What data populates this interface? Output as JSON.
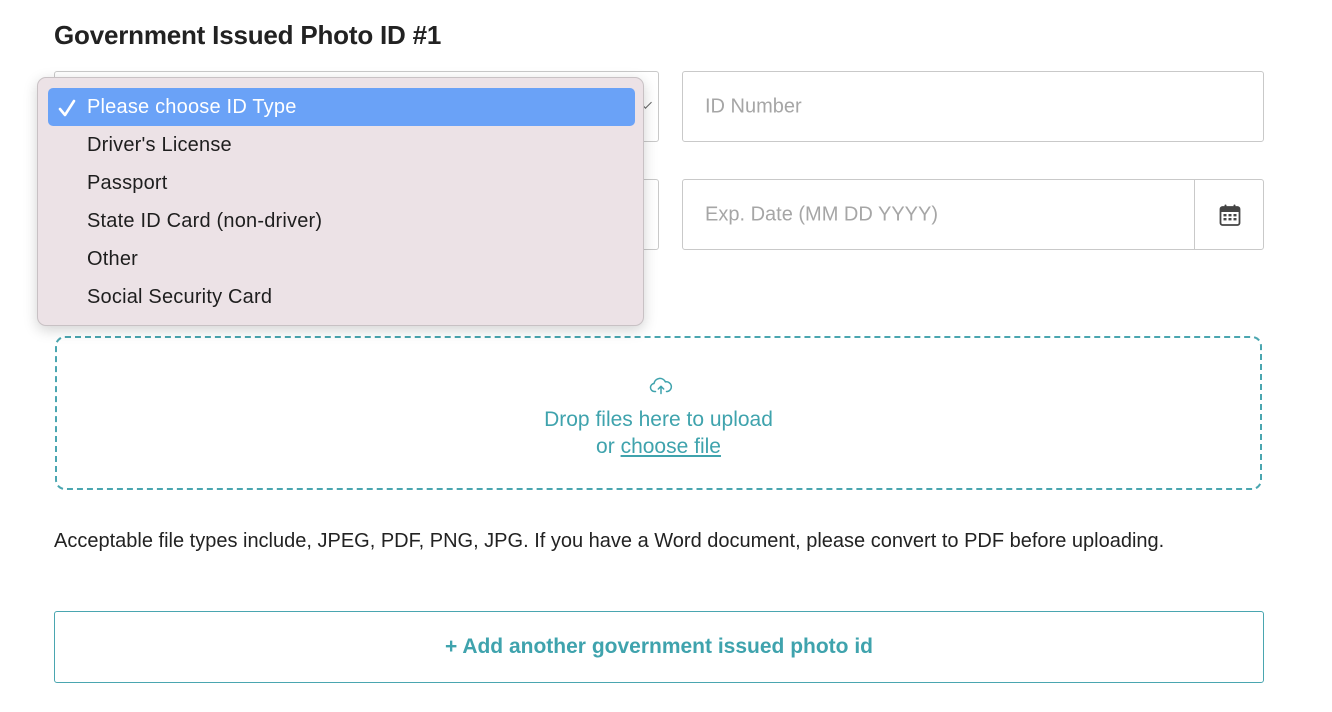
{
  "section": {
    "title": "Government Issued Photo ID #1"
  },
  "id_type_select": {
    "selected": "Please choose ID Type",
    "options": [
      "Please choose ID Type",
      "Driver's License",
      "Passport",
      "State ID Card (non-driver)",
      "Other",
      "Social Security Card"
    ]
  },
  "id_number": {
    "placeholder": "ID Number"
  },
  "exp_date": {
    "placeholder": "Exp. Date (MM DD YYYY)",
    "icon": "calendar-icon"
  },
  "upload": {
    "icon": "cloud-upload-icon",
    "drop_text": "Drop files here to upload",
    "or_text": "or",
    "choose_link": "choose file"
  },
  "help_text": "Acceptable file types include, JPEG, PDF, PNG, JPG. If you have a Word document, please convert to PDF before uploading.",
  "add_button": {
    "label": "+ Add another government issued photo id"
  },
  "colors": {
    "accent": "#3fa3ad",
    "selected_option": "#6aa2f7",
    "dropdown_bg": "#ece2e6",
    "border": "#c9c9c9"
  }
}
